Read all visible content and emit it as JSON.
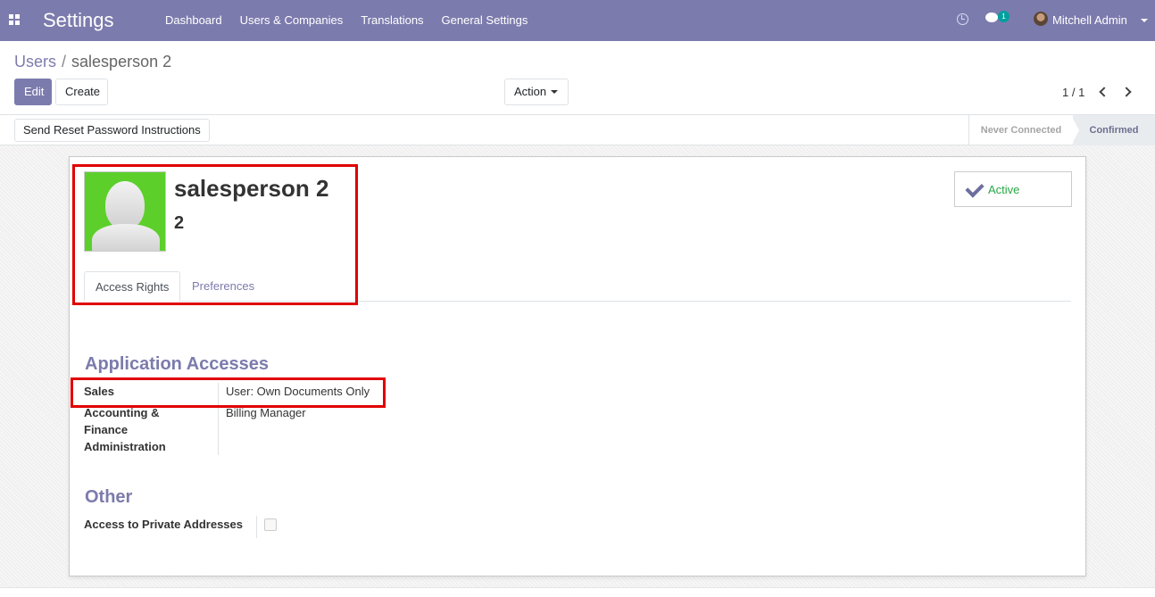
{
  "navbar": {
    "app_title": "Settings",
    "menu": [
      "Dashboard",
      "Users & Companies",
      "Translations",
      "General Settings"
    ],
    "chat_count": "1",
    "user_name": "Mitchell Admin",
    "color": "#7c7bad"
  },
  "breadcrumb": {
    "parent": "Users",
    "separator": "/",
    "current": "salesperson 2"
  },
  "toolbar": {
    "edit_label": "Edit",
    "create_label": "Create",
    "action_label": "Action",
    "pager": "1 / 1"
  },
  "statusbar": {
    "reset_label": "Send Reset Password Instructions",
    "stages": [
      "Never Connected",
      "Confirmed"
    ],
    "current_stage": "Confirmed"
  },
  "record": {
    "name": "salesperson 2",
    "login": "2",
    "active_label": "Active"
  },
  "tabs": [
    "Access Rights",
    "Preferences"
  ],
  "sections": {
    "application_accesses": {
      "title": "Application Accesses",
      "fields": [
        {
          "label": "Sales",
          "value": "User: Own Documents Only"
        },
        {
          "label": "Accounting & Finance Administration",
          "label_lines": [
            "Accounting &",
            "Finance",
            "Administration"
          ],
          "value": "Billing Manager"
        }
      ]
    },
    "other": {
      "title": "Other",
      "fields": [
        {
          "label": "Access to Private Addresses",
          "checked": false
        }
      ]
    }
  }
}
